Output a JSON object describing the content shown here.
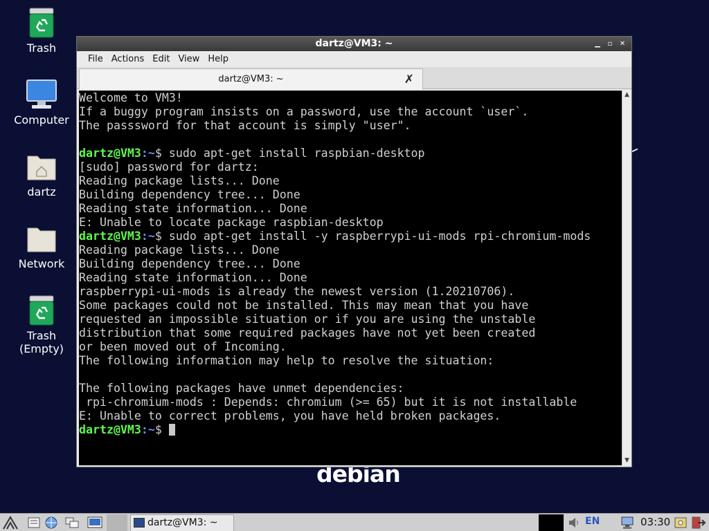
{
  "desktop": {
    "icons": [
      {
        "label": "Trash"
      },
      {
        "label": "Computer"
      },
      {
        "label": "dartz"
      },
      {
        "label": "Network"
      },
      {
        "label": "Trash\n(Empty)"
      }
    ],
    "wallpaper_text": "debian"
  },
  "window": {
    "title": "dartz@VM3: ~",
    "menu": [
      "File",
      "Actions",
      "Edit",
      "View",
      "Help"
    ],
    "tab_title": "dartz@VM3: ~"
  },
  "terminal": {
    "prompt_user": "dartz@VM3",
    "prompt_path": ":~",
    "lines": [
      {
        "text": "Welcome to VM3!"
      },
      {
        "text": "If a buggy program insists on a password, use the account `user`."
      },
      {
        "text": "The passsword for that account is simply \"user\"."
      },
      {
        "text": ""
      },
      {
        "prompt": true,
        "text": "$ sudo apt-get install raspbian-desktop"
      },
      {
        "text": "[sudo] password for dartz:"
      },
      {
        "text": "Reading package lists... Done"
      },
      {
        "text": "Building dependency tree... Done"
      },
      {
        "text": "Reading state information... Done"
      },
      {
        "text": "E: Unable to locate package raspbian-desktop"
      },
      {
        "prompt": true,
        "text": "$ sudo apt-get install -y raspberrypi-ui-mods rpi-chromium-mods"
      },
      {
        "text": "Reading package lists... Done"
      },
      {
        "text": "Building dependency tree... Done"
      },
      {
        "text": "Reading state information... Done"
      },
      {
        "text": "raspberrypi-ui-mods is already the newest version (1.20210706)."
      },
      {
        "text": "Some packages could not be installed. This may mean that you have"
      },
      {
        "text": "requested an impossible situation or if you are using the unstable"
      },
      {
        "text": "distribution that some required packages have not yet been created"
      },
      {
        "text": "or been moved out of Incoming."
      },
      {
        "text": "The following information may help to resolve the situation:"
      },
      {
        "text": ""
      },
      {
        "text": "The following packages have unmet dependencies:"
      },
      {
        "text": " rpi-chromium-mods : Depends: chromium (>= 65) but it is not installable"
      },
      {
        "text": "E: Unable to correct problems, you have held broken packages."
      },
      {
        "prompt": true,
        "text": "$ ",
        "cursor": true
      }
    ]
  },
  "taskbar": {
    "task_label": "dartz@VM3: ~",
    "language": "EN",
    "clock": "03:30"
  },
  "colors": {
    "desktop_bg": "#0a0f33",
    "prompt_user": "#5ff74f",
    "prompt_path": "#6c8cff",
    "terminal_bg": "#000000",
    "terminal_fg": "#d0d0d0"
  }
}
